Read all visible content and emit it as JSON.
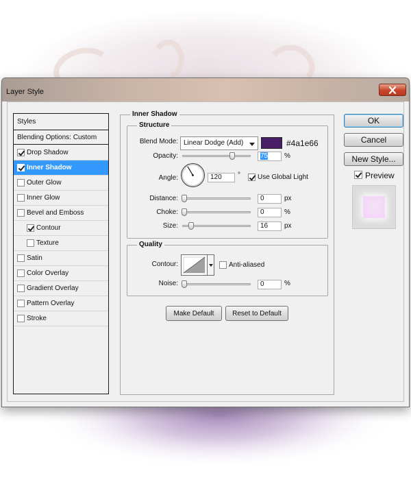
{
  "window": {
    "title": "Layer Style"
  },
  "sidebar": {
    "header": "Styles",
    "blending": "Blending Options: Custom",
    "items": [
      {
        "label": "Drop Shadow",
        "checked": true
      },
      {
        "label": "Inner Shadow",
        "checked": true,
        "selected": true
      },
      {
        "label": "Outer Glow",
        "checked": false
      },
      {
        "label": "Inner Glow",
        "checked": false
      },
      {
        "label": "Bevel and Emboss",
        "checked": false
      },
      {
        "label": "Contour",
        "checked": true,
        "sub": true
      },
      {
        "label": "Texture",
        "checked": false,
        "sub": true
      },
      {
        "label": "Satin",
        "checked": false
      },
      {
        "label": "Color Overlay",
        "checked": false
      },
      {
        "label": "Gradient Overlay",
        "checked": false
      },
      {
        "label": "Pattern Overlay",
        "checked": false
      },
      {
        "label": "Stroke",
        "checked": false
      }
    ]
  },
  "panel": {
    "title": "Inner Shadow",
    "structure": {
      "title": "Structure",
      "blend_mode_label": "Blend Mode:",
      "blend_mode_value": "Linear Dodge (Add)",
      "color": "#4a1e66",
      "color_label": "#4a1e66",
      "opacity_label": "Opacity:",
      "opacity_value": "75",
      "opacity_unit": "%",
      "angle_label": "Angle:",
      "angle_value": "120",
      "angle_unit": "°",
      "global_light_label": "Use Global Light",
      "global_light_checked": true,
      "distance_label": "Distance:",
      "distance_value": "0",
      "distance_unit": "px",
      "choke_label": "Choke:",
      "choke_value": "0",
      "choke_unit": "%",
      "size_label": "Size:",
      "size_value": "16",
      "size_unit": "px"
    },
    "quality": {
      "title": "Quality",
      "contour_label": "Contour:",
      "anti_aliased_label": "Anti-aliased",
      "anti_aliased_checked": false,
      "noise_label": "Noise:",
      "noise_value": "0",
      "noise_unit": "%"
    },
    "make_default_label": "Make Default",
    "reset_default_label": "Reset to Default"
  },
  "buttons": {
    "ok": "OK",
    "cancel": "Cancel",
    "new_style": "New Style...",
    "preview_label": "Preview",
    "preview_checked": true
  },
  "colors": {
    "selection": "#3399ff",
    "shadow_color": "#4a1e66"
  }
}
